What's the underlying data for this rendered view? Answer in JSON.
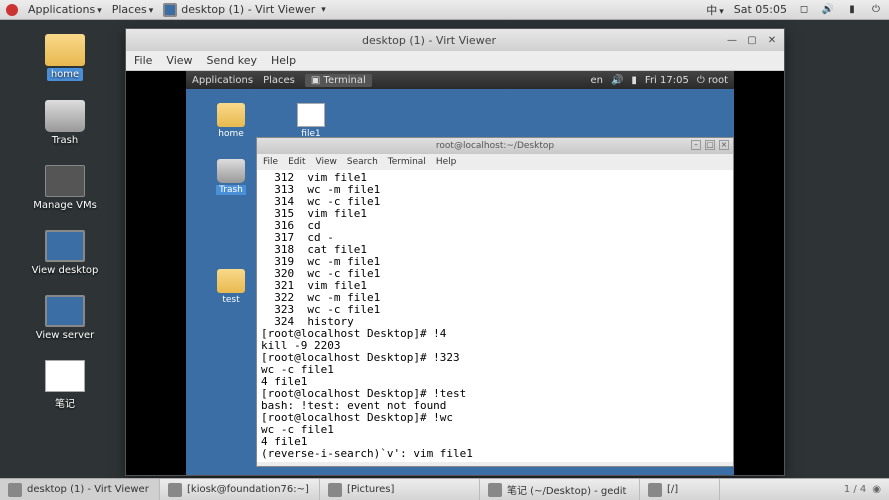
{
  "top_panel": {
    "apps": "Applications",
    "places": "Places",
    "vv": "desktop (1) - Virt Viewer",
    "lang": "中",
    "day_time": "Sat 05:05"
  },
  "desktop_icons": {
    "home": "home",
    "trash": "Trash",
    "vms": "Manage VMs",
    "viewd": "View desktop",
    "views": "View server",
    "note": "笔记"
  },
  "virt_window": {
    "title": "desktop (1) - Virt Viewer",
    "menu": {
      "file": "File",
      "view": "View",
      "send": "Send key",
      "help": "Help"
    }
  },
  "inner_panel": {
    "apps": "Applications",
    "places": "Places",
    "term": "Terminal",
    "lang": "en",
    "time": "Fri 17:05",
    "user": "root"
  },
  "inner_icons": {
    "home": "home",
    "file1": "file1",
    "trash": "Trash",
    "test": "test"
  },
  "terminal": {
    "title": "root@localhost:~/Desktop",
    "menu": {
      "file": "File",
      "edit": "Edit",
      "view": "View",
      "search": "Search",
      "terminal": "Terminal",
      "help": "Help"
    },
    "lines": [
      "  312  vim file1",
      "  313  wc -m file1",
      "  314  wc -c file1",
      "  315  vim file1",
      "  316  cd",
      "  317  cd -",
      "  318  cat file1",
      "  319  wc -m file1",
      "  320  wc -c file1",
      "  321  vim file1",
      "  322  wc -m file1",
      "  323  wc -c file1",
      "  324  history",
      "[root@localhost Desktop]# !4",
      "kill -9 2203",
      "[root@localhost Desktop]# !323",
      "wc -c file1",
      "4 file1",
      "[root@localhost Desktop]# !test",
      "bash: !test: event not found",
      "[root@localhost Desktop]# !wc",
      "wc -c file1",
      "4 file1",
      "(reverse-i-search)`v': vim file1"
    ]
  },
  "taskbar": {
    "t1": "desktop (1) - Virt Viewer",
    "t2": "[kiosk@foundation76:~]",
    "t3": "[Pictures]",
    "t4": "笔记 (~/Desktop) - gedit",
    "t5": "[/]",
    "pager": "1 / 4"
  }
}
